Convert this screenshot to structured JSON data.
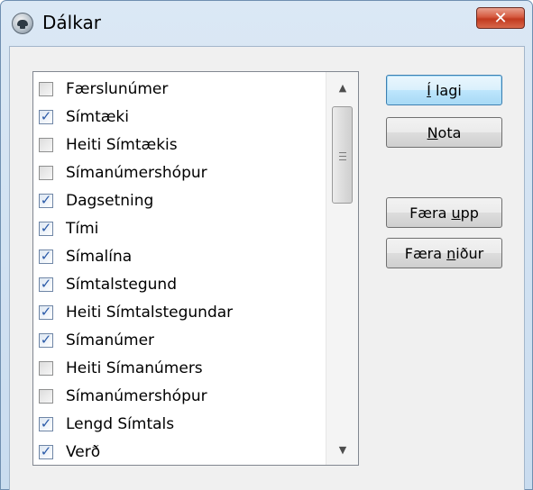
{
  "window": {
    "title": "Dálkar",
    "icon": "telephone-icon",
    "close_symbol": "✕"
  },
  "columns_list": {
    "items": [
      {
        "label": "Færslunúmer",
        "checked": false
      },
      {
        "label": "Símtæki",
        "checked": true
      },
      {
        "label": "Heiti Símtækis",
        "checked": false
      },
      {
        "label": "Símanúmershópur",
        "checked": false
      },
      {
        "label": "Dagsetning",
        "checked": true
      },
      {
        "label": "Tími",
        "checked": true
      },
      {
        "label": "Símalína",
        "checked": true
      },
      {
        "label": "Símtalstegund",
        "checked": true
      },
      {
        "label": "Heiti Símtalstegundar",
        "checked": true
      },
      {
        "label": "Símanúmer",
        "checked": true
      },
      {
        "label": "Heiti Símanúmers",
        "checked": false
      },
      {
        "label": "Símanúmershópur",
        "checked": false
      },
      {
        "label": "Lengd Símtals",
        "checked": true
      },
      {
        "label": "Verð",
        "checked": true
      }
    ],
    "check_glyph": "✓",
    "scroll_up_glyph": "▲",
    "scroll_down_glyph": "▼"
  },
  "buttons": {
    "ok": {
      "mnemonic": "Í",
      "rest": " lagi"
    },
    "apply": {
      "mnemonic": "N",
      "rest": "ota"
    },
    "move_up": {
      "prefix": "Færa ",
      "mnemonic": "u",
      "rest": "pp"
    },
    "move_down": {
      "prefix": "Færa ",
      "mnemonic": "n",
      "rest": "iður"
    }
  },
  "colors": {
    "title_bar": "#dbe8f5",
    "close_button": "#c94a2f",
    "dialog_bg": "#f0f0f0",
    "default_button": "#bee6fd",
    "checkmark": "#2a5aa8"
  }
}
